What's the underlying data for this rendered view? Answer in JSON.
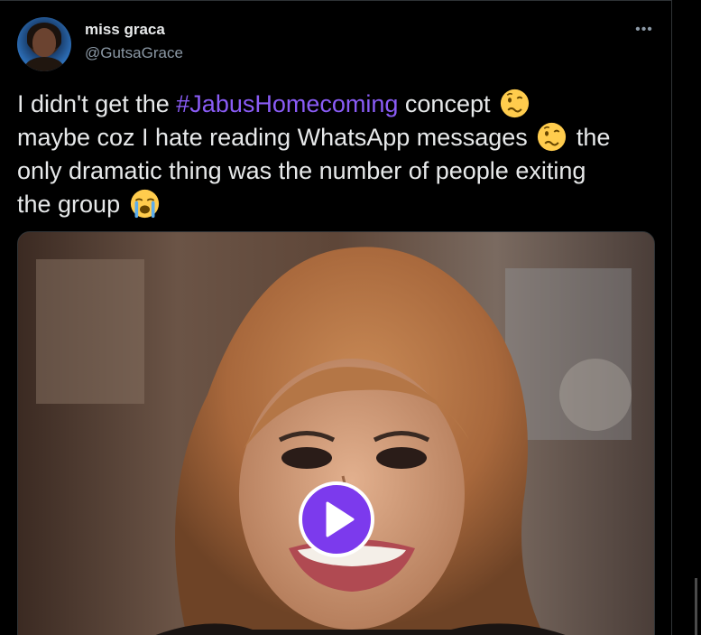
{
  "tweet": {
    "display_name": "miss graca",
    "handle": "@GutsaGrace",
    "more_label": "•••",
    "text": {
      "part1": "I didn't get the ",
      "hashtag": "#JabusHomecoming",
      "part2": "  concept",
      "line2": "maybe coz I hate reading WhatsApp messages",
      "part3": " the",
      "line3": "only dramatic thing was the number of people exiting",
      "line4": "the group"
    },
    "emojis": [
      "woozy-face-icon",
      "woozy-face-icon",
      "loudly-crying-face-icon"
    ],
    "media": {
      "type": "video",
      "play_icon": "play-icon"
    }
  },
  "colors": {
    "background": "#000000",
    "text": "#e7e9ea",
    "secondary": "#8b98a5",
    "hashtag": "#8a5cf6",
    "play_button": "#7c3aed"
  }
}
